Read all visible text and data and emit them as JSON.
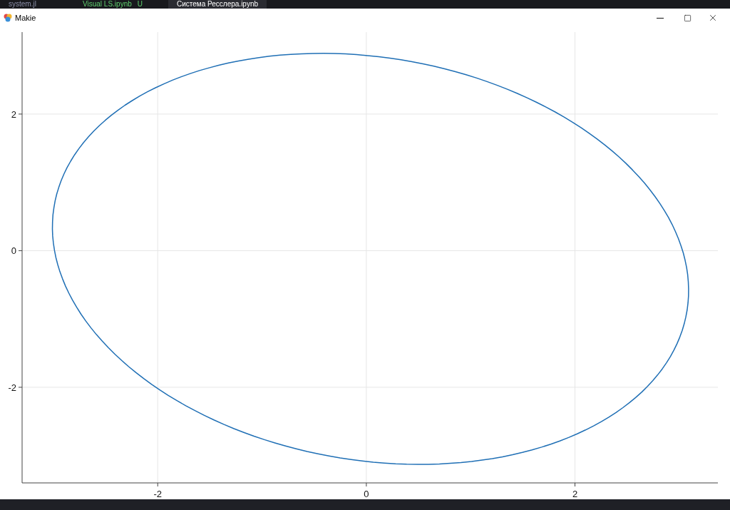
{
  "editor_tabs": [
    {
      "label": "system.jl",
      "selected": false
    },
    {
      "label": "Visual LS.ipynb",
      "status": "U",
      "selected": false
    },
    {
      "label": "Система Ресслера.ipynb",
      "selected": true
    }
  ],
  "window": {
    "title": "Makie"
  },
  "plot": {
    "grid": true,
    "x_tick_labels": [
      "-2",
      "0",
      "2"
    ],
    "y_tick_labels": [
      "2",
      "0",
      "-2"
    ]
  }
}
